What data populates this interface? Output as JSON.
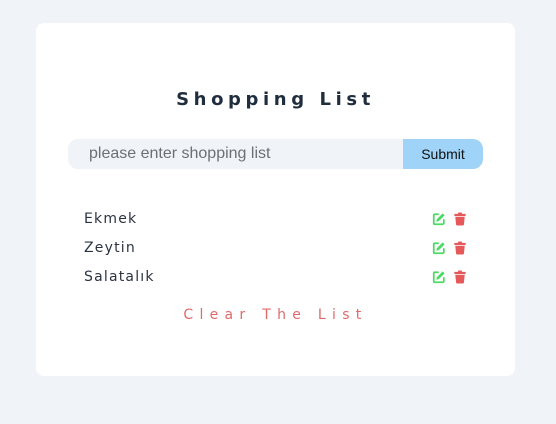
{
  "app": {
    "title": "Shopping List"
  },
  "form": {
    "placeholder": "please enter shopping list",
    "value": "",
    "submit_label": "Submit"
  },
  "items": [
    {
      "label": "Ekmek",
      "edit_icon": "edit-icon",
      "delete_icon": "trash-icon"
    },
    {
      "label": "Zeytin",
      "edit_icon": "edit-icon",
      "delete_icon": "trash-icon"
    },
    {
      "label": "Salatalık",
      "edit_icon": "edit-icon",
      "delete_icon": "trash-icon"
    }
  ],
  "clear_label": "Clear The List",
  "colors": {
    "page_background": "#f0f3f7",
    "card_background": "#ffffff",
    "title": "#1f2d3d",
    "submit_background": "#9fd3f7",
    "edit_icon": "#4cd964",
    "delete_icon": "#e5595b",
    "clear_text": "#e06a6a"
  }
}
